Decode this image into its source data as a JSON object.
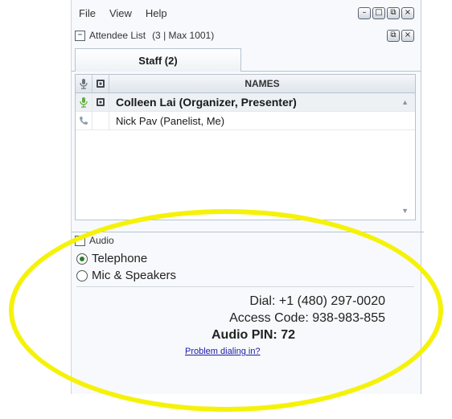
{
  "menu": [
    "File",
    "View",
    "Help"
  ],
  "window_buttons": [
    "–",
    "□",
    "⧉",
    "×"
  ],
  "attendee_section": {
    "title": "Attendee List",
    "count": "(3 | Max 1001)",
    "buttons": [
      "⧉",
      "×"
    ]
  },
  "tabs": [
    {
      "label": "Staff (2)"
    }
  ],
  "table": {
    "header": "NAMES",
    "rows": [
      {
        "name": "Colleen Lai (Organizer, Presenter)",
        "icon": "microphone-icon"
      },
      {
        "name": "Nick Pav (Panelist, Me)",
        "icon": "phone-icon"
      }
    ]
  },
  "audio": {
    "title": "Audio",
    "options": [
      {
        "label": "Telephone",
        "checked": true
      },
      {
        "label": "Mic & Speakers",
        "checked": false
      }
    ],
    "dial_label": "Dial:",
    "dial_value": "+1 (480) 297-0020",
    "access_label": "Access Code:",
    "access_value": "938-983-855",
    "pin_label": "Audio PIN:",
    "pin_value": "72",
    "help_link": "Problem dialing in?"
  },
  "colors": {
    "highlight": "#f5f20a",
    "link": "#1a1aa8",
    "mic_green": "#5fae3a"
  }
}
